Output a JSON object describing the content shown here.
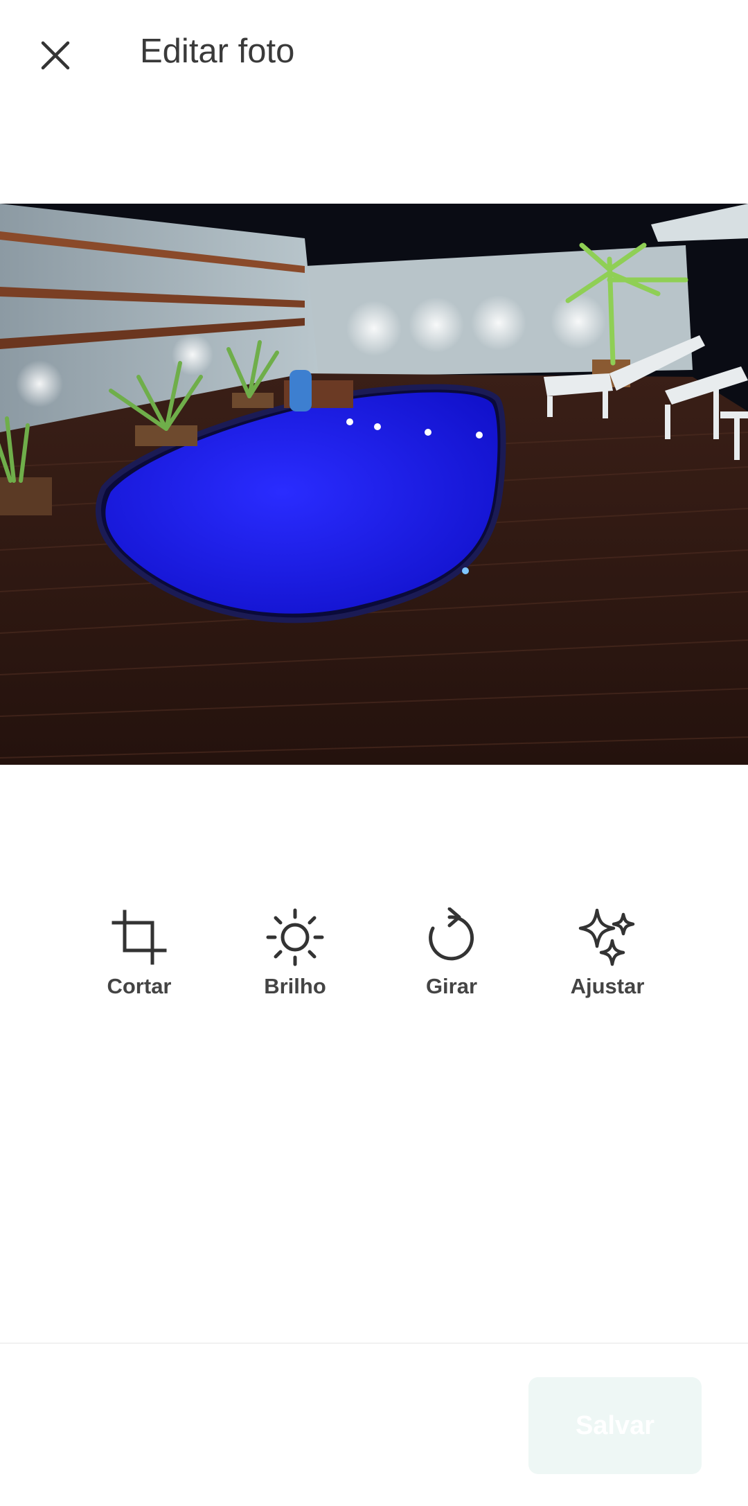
{
  "header": {
    "title": "Editar foto",
    "close_icon": "close-icon"
  },
  "photo": {
    "subject": "Piscina iluminada à noite com deck de madeira",
    "pool_color": "#1d1df0"
  },
  "tools": [
    {
      "label": "Cortar",
      "icon": "crop-icon"
    },
    {
      "label": "Brilho",
      "icon": "brightness-icon"
    },
    {
      "label": "Girar",
      "icon": "rotate-icon"
    },
    {
      "label": "Ajustar",
      "icon": "sparkle-icon"
    }
  ],
  "footer": {
    "save_label": "Salvar",
    "save_color": "#eef7f5"
  }
}
